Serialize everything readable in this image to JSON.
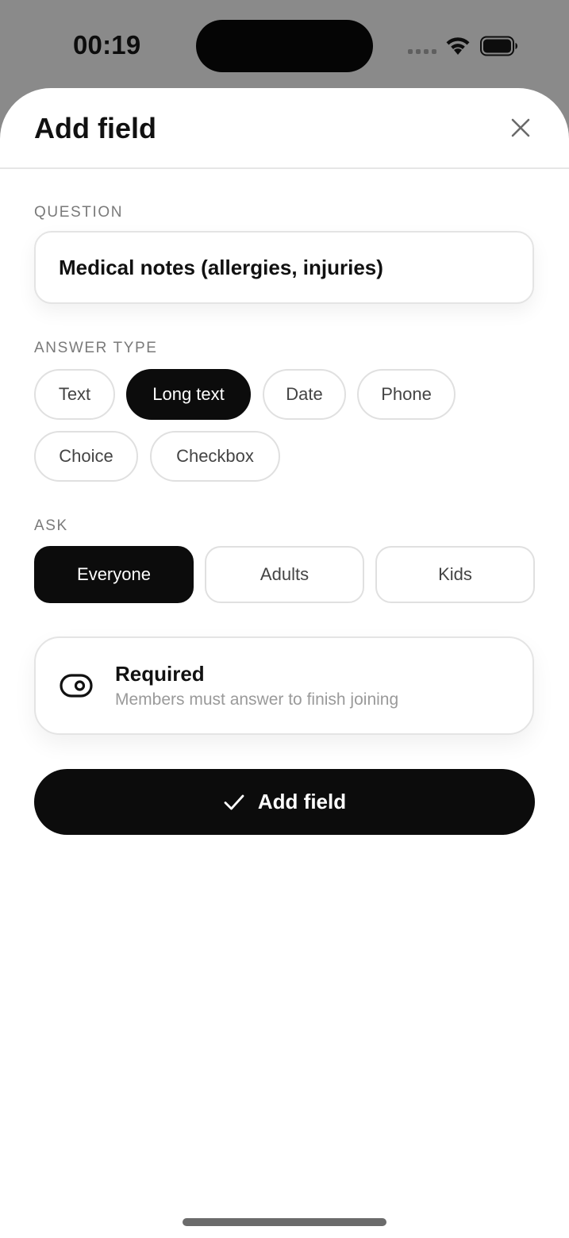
{
  "status_bar": {
    "time": "00:19"
  },
  "sheet": {
    "title": "Add field",
    "close_icon": "close-icon"
  },
  "question": {
    "label": "QUESTION",
    "value": "Medical notes (allergies, injuries)"
  },
  "answer_type": {
    "label": "ANSWER TYPE",
    "options": [
      "Text",
      "Long text",
      "Date",
      "Phone",
      "Choice",
      "Checkbox"
    ],
    "selected": "Long text"
  },
  "ask": {
    "label": "ASK",
    "options": [
      "Everyone",
      "Adults",
      "Kids"
    ],
    "selected": "Everyone"
  },
  "required": {
    "title": "Required",
    "subtitle": "Members must answer to finish joining",
    "icon": "toggle-icon"
  },
  "primary_button": {
    "label": "Add field",
    "icon": "check-icon"
  },
  "colors": {
    "backdrop": "#8a8a8a",
    "sheet": "#ffffff",
    "accent": "#0c0c0c",
    "muted_text": "#9a9a9a"
  }
}
